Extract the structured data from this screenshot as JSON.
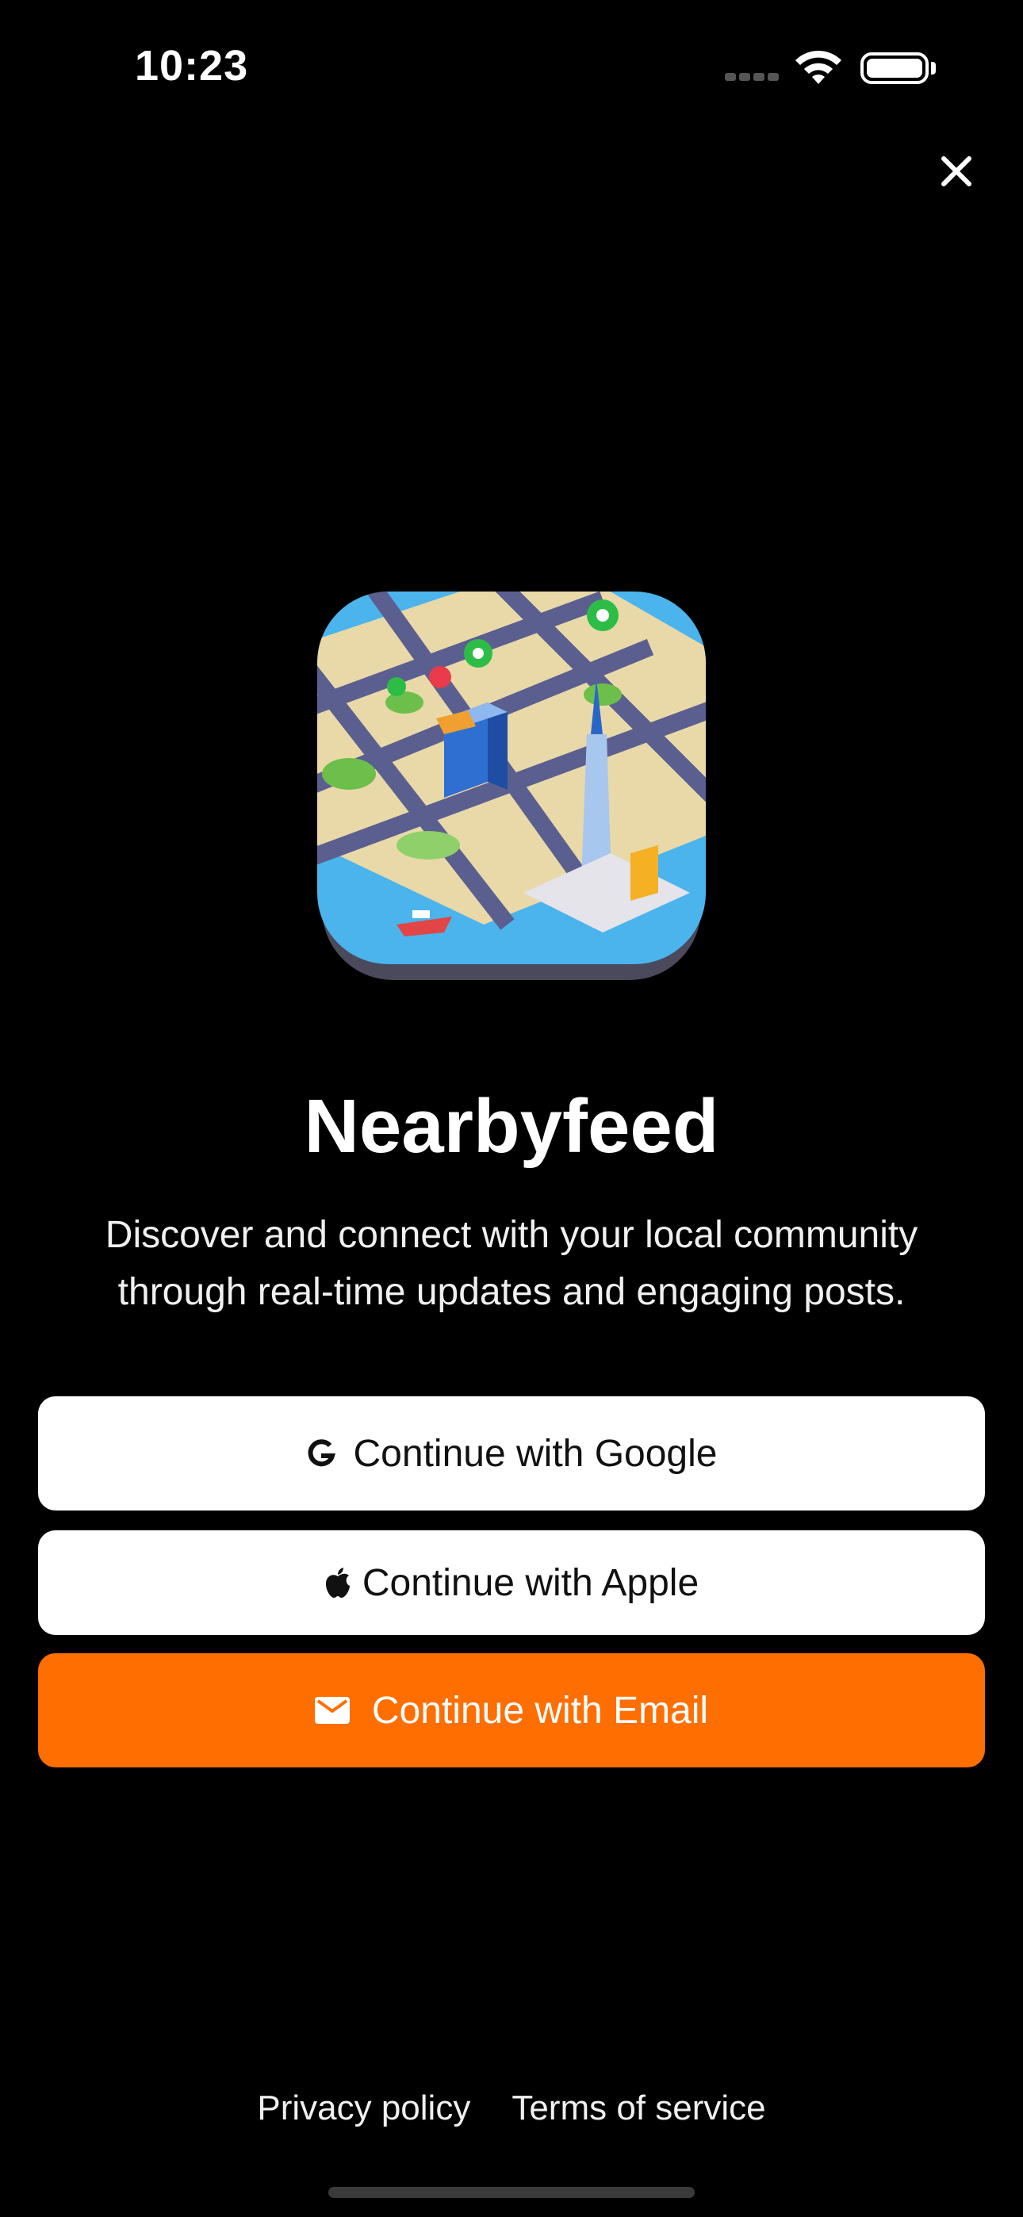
{
  "status_bar": {
    "time": "10:23",
    "signal": "signal-bars-icon",
    "wifi": "wifi-icon",
    "battery": "battery-icon"
  },
  "header": {
    "close_icon": "close-icon"
  },
  "app": {
    "icon": "city-map-app-icon",
    "name": "Nearbyfeed",
    "description": "Discover and connect with your local community through real-time updates and engaging posts."
  },
  "auth": {
    "google_label": "Continue with Google",
    "google_icon": "google-icon",
    "apple_label": "Continue with Apple",
    "apple_icon": "apple-icon",
    "email_label": "Continue with Email",
    "email_icon": "mail-icon"
  },
  "footer": {
    "privacy_label": "Privacy policy",
    "terms_label": "Terms of service"
  },
  "colors": {
    "background": "#000000",
    "primary_button": "#ff6e00",
    "secondary_button": "#ffffff"
  }
}
